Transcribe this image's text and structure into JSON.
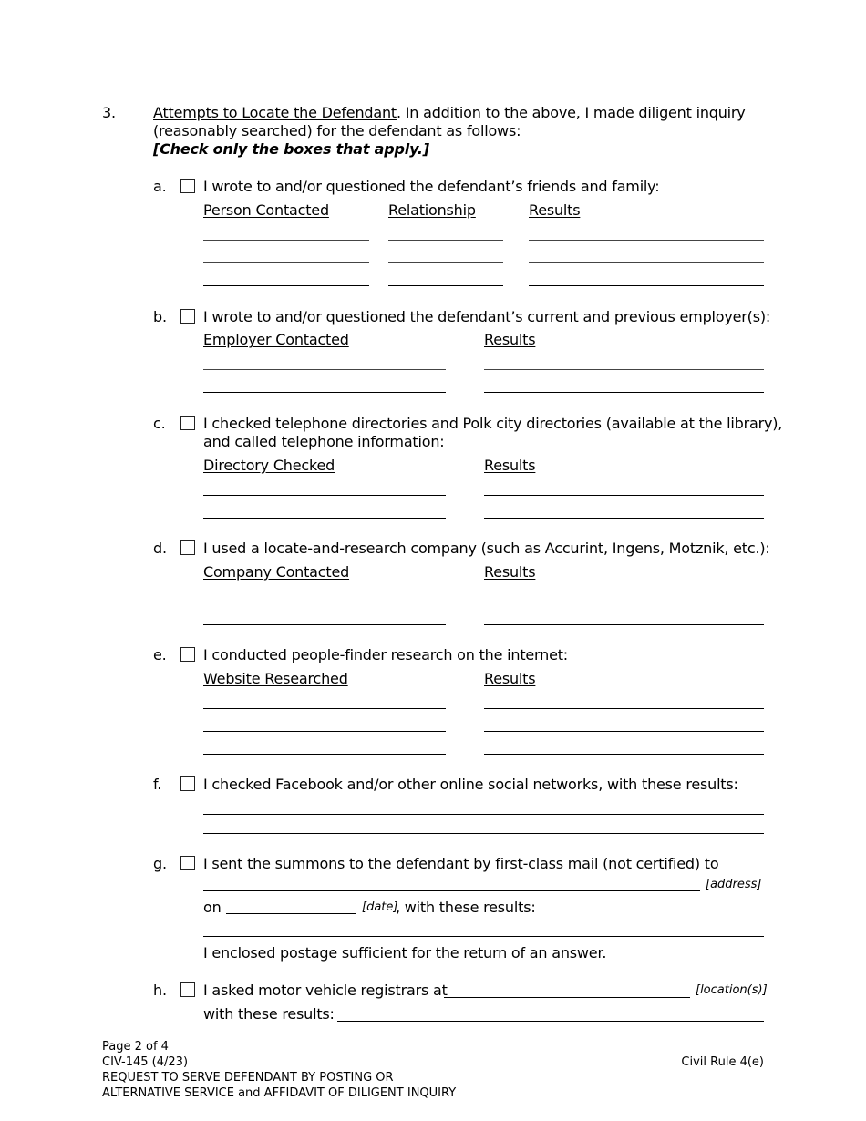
{
  "section": {
    "number": "3.",
    "title": "Attempts to Locate the Defendant",
    "intro_line1": ".  In addition to the above, I made diligent inquiry",
    "intro_line2": "(reasonably searched) for the defendant as follows:",
    "instruction": "[Check only the boxes that apply.]"
  },
  "items": {
    "a": {
      "letter": "a.",
      "checked": false,
      "text": "I wrote to and/or questioned the defendant’s friends and family:",
      "columns": [
        "Person Contacted",
        "Relationship",
        "Results"
      ]
    },
    "b": {
      "letter": "b.",
      "checked": false,
      "text": "I wrote to and/or questioned the defendant’s current and previous employer(s):",
      "columns": [
        "Employer Contacted",
        "Results"
      ]
    },
    "c": {
      "letter": "c.",
      "checked": false,
      "text_line1": "I checked telephone directories and Polk city directories (available at the library),",
      "text_line2": "and called telephone information:",
      "columns": [
        "Directory Checked",
        "Results"
      ]
    },
    "d": {
      "letter": "d.",
      "checked": false,
      "text": "I used a locate-and-research company (such as Accurint, Ingens, Motznik, etc.):",
      "columns": [
        "Company Contacted",
        "Results"
      ]
    },
    "e": {
      "letter": "e.",
      "checked": false,
      "text": "I conducted people-finder research on the internet:",
      "columns": [
        "Website Researched",
        "Results"
      ]
    },
    "f": {
      "letter": "f.",
      "checked": false,
      "text": "I checked Facebook and/or other online social networks, with these results:"
    },
    "g": {
      "letter": "g.",
      "checked": false,
      "text": "I sent the summons to the defendant by first-class mail (not certified) to",
      "address_hint": "[address]",
      "on_label": "on",
      "date_hint": "[date]",
      "results_label": ", with these results:",
      "postage_note": "I enclosed postage sufficient for the return of an answer."
    },
    "h": {
      "letter": "h.",
      "checked": false,
      "text": "I asked motor vehicle registrars at",
      "location_hint": "[location(s)]",
      "results_label": "with these results:"
    }
  },
  "footer": {
    "page": "Page 2 of 4",
    "form_id": "CIV-145 (4/23)",
    "title_line1": "REQUEST TO SERVE DEFENDANT BY POSTING OR",
    "title_line2": "ALTERNATIVE SERVICE and AFFIDAVIT OF DILIGENT INQUIRY",
    "rule": "Civil Rule 4(e)"
  }
}
